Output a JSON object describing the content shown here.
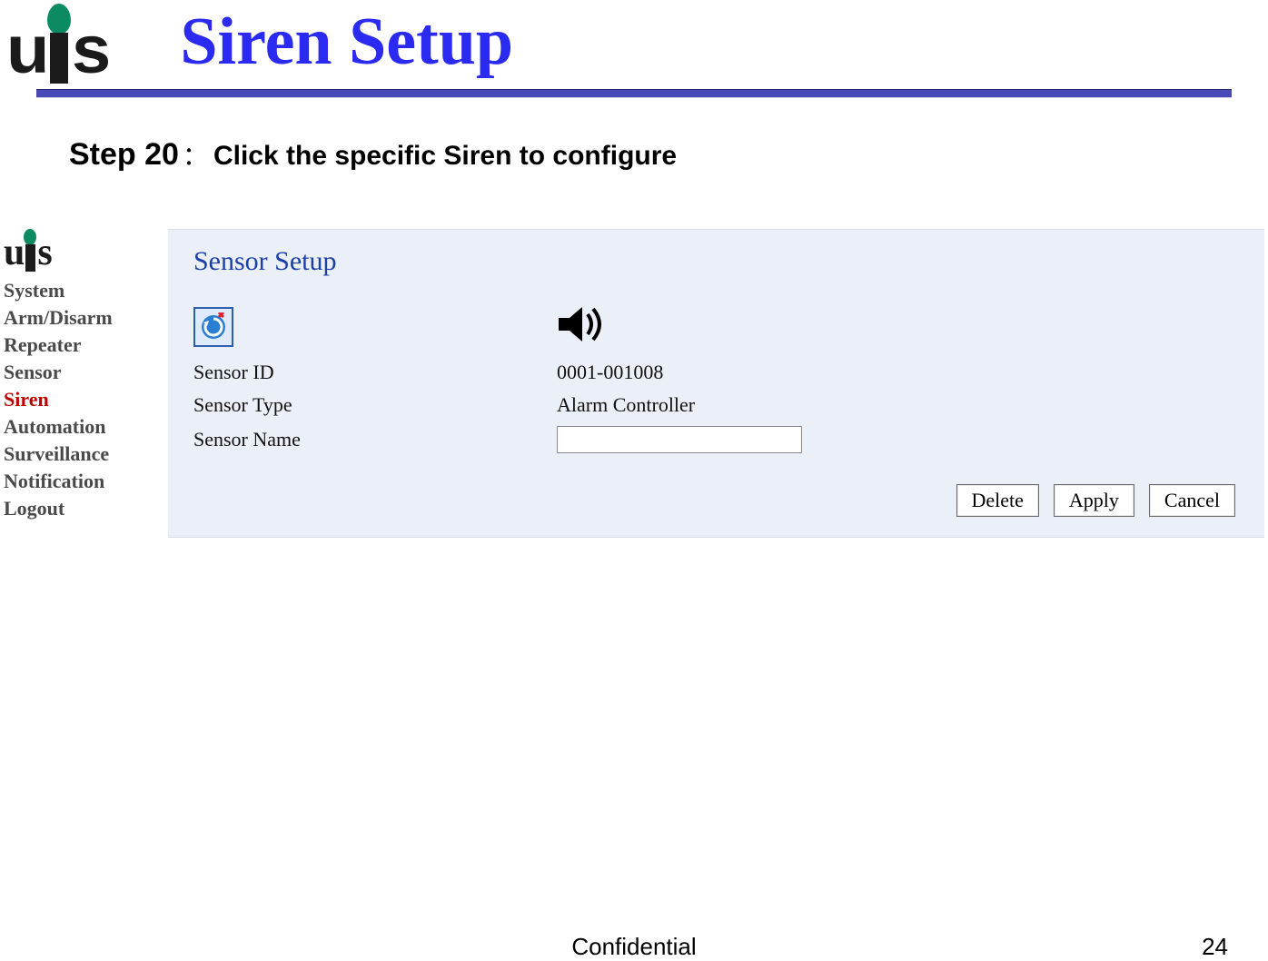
{
  "slide": {
    "logo_text": "uis",
    "title": "Siren Setup",
    "step_label": "Step 20",
    "step_colon": "：",
    "step_desc": "Click the specific Siren to configure"
  },
  "sidebar": {
    "logo_text": "uis",
    "items": [
      {
        "label": "System",
        "active": false
      },
      {
        "label": "Arm/Disarm",
        "active": false
      },
      {
        "label": "Repeater",
        "active": false
      },
      {
        "label": "Sensor",
        "active": false
      },
      {
        "label": "Siren",
        "active": true
      },
      {
        "label": "Automation",
        "active": false
      },
      {
        "label": "Surveillance",
        "active": false
      },
      {
        "label": "Notification",
        "active": false
      },
      {
        "label": "Logout",
        "active": false
      }
    ]
  },
  "panel": {
    "title": "Sensor Setup",
    "rows": {
      "sensor_id_label": "Sensor ID",
      "sensor_id_value": "0001-001008",
      "sensor_type_label": "Sensor Type",
      "sensor_type_value": "Alarm Controller",
      "sensor_name_label": "Sensor Name",
      "sensor_name_value": ""
    },
    "buttons": {
      "delete": "Delete",
      "apply": "Apply",
      "cancel": "Cancel"
    }
  },
  "footer": {
    "center": "Confidential",
    "page_number": "24"
  }
}
